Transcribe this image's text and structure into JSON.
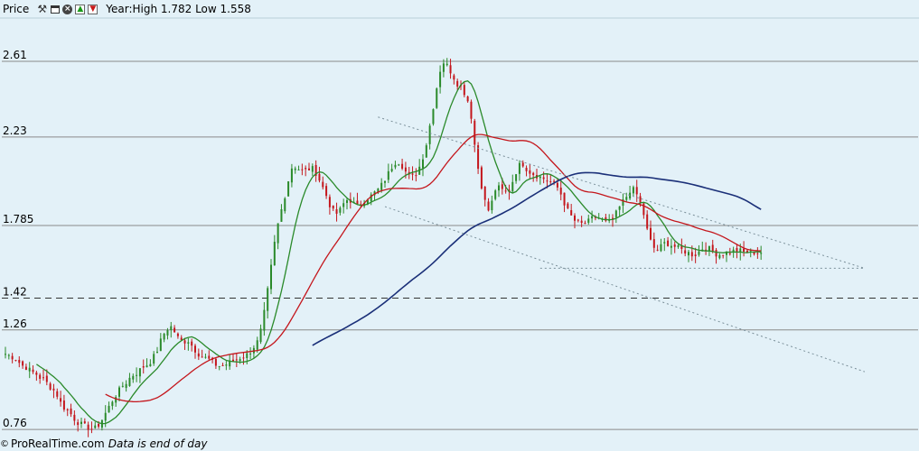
{
  "toolbar": {
    "title": "Price",
    "icons": [
      "wrench-icon",
      "window-icon",
      "close-icon",
      "move-up-icon",
      "move-down-icon"
    ],
    "high_low": "Year:High 1.782 Low 1.558"
  },
  "footer": {
    "copyright": "©",
    "source": "ProRealTime.com",
    "note": "Data is end of day"
  },
  "chart_data": {
    "type": "candlestick",
    "price_axis_side": "left",
    "y_ticks": [
      "2.61",
      "2.23",
      "1.785",
      "1.42",
      "1.26",
      "0.76"
    ],
    "y_tick_values": [
      2.61,
      2.23,
      1.785,
      1.42,
      1.26,
      0.76
    ],
    "dashed_level": 1.42,
    "ylim": [
      0.5,
      2.86
    ],
    "bar_count": 220,
    "candles_close": [
      1.14,
      1.13,
      1.12,
      1.1,
      1.08,
      1.07,
      1.05,
      1.04,
      1.02,
      1.01,
      0.98,
      0.96,
      0.93,
      0.88,
      0.86,
      0.84,
      0.81,
      0.79,
      0.78,
      0.77,
      0.76,
      0.77,
      0.8,
      0.84,
      0.88,
      0.92,
      0.95,
      0.98,
      1.0,
      1.03,
      1.04,
      1.06,
      1.08,
      1.09,
      1.12,
      1.16,
      1.22,
      1.26,
      1.28,
      1.25,
      1.21,
      1.2,
      1.21,
      1.18,
      1.15,
      1.13,
      1.12,
      1.11,
      1.09,
      1.08,
      1.08,
      1.09,
      1.1,
      1.11,
      1.12,
      1.13,
      1.14,
      1.17,
      1.2,
      1.27,
      1.4,
      1.55,
      1.7,
      1.82,
      1.9,
      2.0,
      2.08,
      2.08,
      2.06,
      2.06,
      2.07,
      2.07,
      2.03,
      1.98,
      1.93,
      1.87,
      1.84,
      1.86,
      1.9,
      1.92,
      1.9,
      1.88,
      1.9,
      1.92,
      1.93,
      1.95,
      1.97,
      2.0,
      2.04,
      2.08,
      2.11,
      2.1,
      2.06,
      2.03,
      2.03,
      2.06,
      2.12,
      2.2,
      2.32,
      2.44,
      2.56,
      2.61,
      2.58,
      2.54,
      2.5,
      2.48,
      2.44,
      2.38,
      2.2,
      2.05,
      1.95,
      1.85,
      1.9,
      1.98,
      1.97,
      1.95,
      1.96,
      2.02,
      2.08,
      2.1,
      2.07,
      2.05,
      2.04,
      2.03,
      2.02,
      2.01,
      2.0,
      1.98,
      1.94,
      1.88,
      1.84,
      1.81,
      1.8,
      1.79,
      1.8,
      1.82,
      1.83,
      1.82,
      1.8,
      1.8,
      1.82,
      1.86,
      1.9,
      1.93,
      1.97,
      1.96,
      1.91,
      1.84,
      1.74,
      1.68,
      1.66,
      1.68,
      1.7,
      1.69,
      1.68,
      1.67,
      1.66,
      1.65,
      1.64,
      1.64,
      1.66,
      1.68,
      1.67,
      1.65,
      1.64,
      1.64,
      1.65,
      1.65,
      1.66,
      1.66,
      1.65,
      1.65,
      1.65,
      1.65,
      1.65
    ],
    "moving_averages": [
      {
        "color": "#2a8a2a",
        "period": 10
      },
      {
        "color": "#c4161c",
        "period": 30
      },
      {
        "color": "#1a2f78",
        "period": 90
      }
    ],
    "trendlines": [
      {
        "style": "dotted",
        "from": [
          108,
          2.33
        ],
        "to": [
          215,
          1.57
        ]
      },
      {
        "style": "dotted",
        "from": [
          110,
          1.88
        ],
        "to": [
          215,
          1.05
        ]
      },
      {
        "style": "dotted",
        "from": [
          155,
          1.57
        ],
        "to": [
          215,
          1.57
        ]
      }
    ],
    "candle_color_up": "#2a8a2a",
    "candle_color_down": "#c4161c"
  }
}
